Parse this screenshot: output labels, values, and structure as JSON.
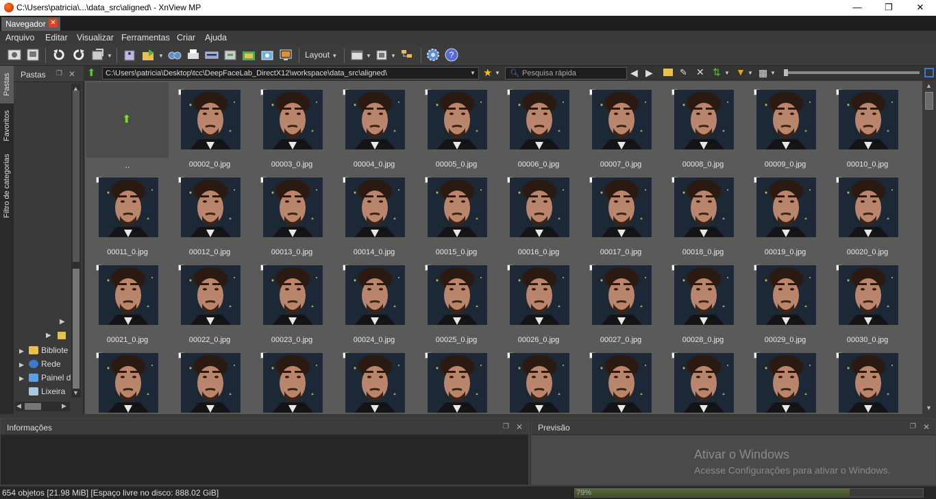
{
  "window": {
    "title": "C:\\Users\\patricia\\...\\data_src\\aligned\\ - XnView MP",
    "controls": {
      "minimize": "—",
      "maximize": "❐",
      "close": "✕"
    }
  },
  "tabs": [
    {
      "label": "Navegador",
      "close": "✕"
    }
  ],
  "menu": [
    "Arquivo",
    "Editar",
    "Visualizar",
    "Ferramentas",
    "Criar",
    "Ajuda"
  ],
  "toolbar": {
    "layout_label": "Layout",
    "icons": [
      "fullscreen-icon",
      "slideshow-icon",
      "rotate-left-icon",
      "rotate-right-icon",
      "refresh-icon",
      "properties-icon",
      "export-icon",
      "find-icon",
      "print-icon",
      "scanner-icon",
      "batch-convert-icon",
      "move-icon",
      "capture-icon",
      "wallpaper-icon",
      "settings-icon",
      "help-icon"
    ]
  },
  "sidebar": {
    "vertical_tabs": [
      "Pastas",
      "Favoritos",
      "Filtro de categorias"
    ],
    "panel_title": "Pastas",
    "tree": [
      {
        "label": "Bibliote",
        "icon": "library-icon"
      },
      {
        "label": "Rede",
        "icon": "network-icon"
      },
      {
        "label": "Painel d",
        "icon": "control-panel-icon"
      },
      {
        "label": "Lixeira",
        "icon": "recycle-bin-icon"
      }
    ]
  },
  "address": {
    "path": "C:\\Users\\patricia\\Desktop\\tcc\\DeepFaceLab_DirectX12\\workspace\\data_src\\aligned\\",
    "search_placeholder": "Pesquisa rápida"
  },
  "browser": {
    "parent_label": "..",
    "files": [
      "00002_0.jpg",
      "00003_0.jpg",
      "00004_0.jpg",
      "00005_0.jpg",
      "00006_0.jpg",
      "00007_0.jpg",
      "00008_0.jpg",
      "00009_0.jpg",
      "00010_0.jpg",
      "00011_0.jpg",
      "00012_0.jpg",
      "00013_0.jpg",
      "00014_0.jpg",
      "00015_0.jpg",
      "00016_0.jpg",
      "00017_0.jpg",
      "00018_0.jpg",
      "00019_0.jpg",
      "00020_0.jpg",
      "00021_0.jpg",
      "00022_0.jpg",
      "00023_0.jpg",
      "00024_0.jpg",
      "00025_0.jpg",
      "00026_0.jpg",
      "00027_0.jpg",
      "00028_0.jpg",
      "00029_0.jpg",
      "00030_0.jpg",
      "",
      "",
      "",
      "",
      "",
      "",
      "",
      "",
      "",
      ""
    ]
  },
  "panels": {
    "info_title": "Informações",
    "preview_title": "Previsão",
    "watermark_line1": "Ativar o Windows",
    "watermark_line2": "Acesse Configurações para ativar o Windows."
  },
  "status": {
    "text": "654 objetos [21.98 MiB] [Espaço livre no disco: 888.02 GiB]",
    "progress_label": "79%",
    "progress_value": 0.79
  },
  "colors": {
    "accent": "#e04020",
    "grid_bg": "#5a5a5a",
    "thumb_bg": "#1c2836"
  }
}
